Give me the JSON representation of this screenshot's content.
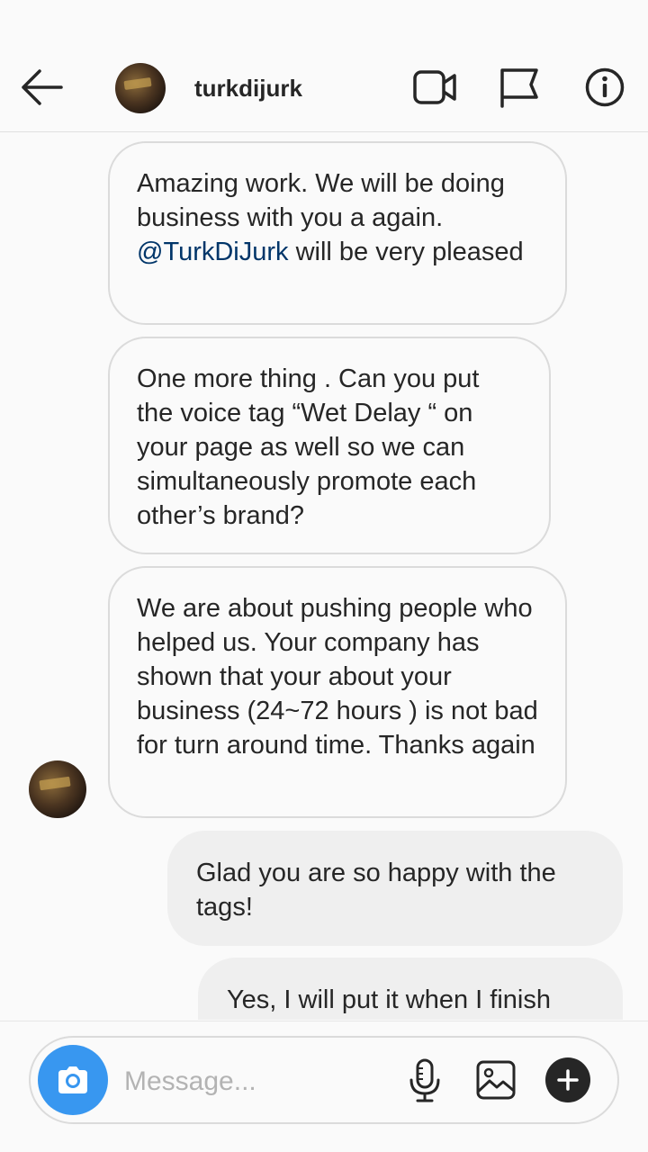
{
  "header": {
    "username": "turkdijurk"
  },
  "messages": [
    {
      "direction": "incoming",
      "parts": [
        "Amazing work. We will be doing business with you a again. ",
        "@TurkDiJurk",
        " will be very pleased"
      ]
    },
    {
      "direction": "incoming",
      "text": "One more thing . Can you put the voice tag “Wet Delay “ on your page as well so we can simultaneously promote each other’s brand?"
    },
    {
      "direction": "incoming",
      "text": "We are about pushing people who helped us. Your company has shown that your about your business (24~72 hours ) is not bad for turn around time. Thanks again"
    },
    {
      "direction": "outgoing",
      "text": "Glad you are so happy with the tags!"
    },
    {
      "direction": "outgoing",
      "text": "Yes, I will put it when I finish"
    }
  ],
  "composer": {
    "placeholder": "Message..."
  },
  "colors": {
    "accent": "#3897f0",
    "mention": "#003569",
    "outgoing_bubble": "#efefef",
    "incoming_border": "#dbdbdb"
  },
  "icons": [
    "back-arrow-icon",
    "video-call-icon",
    "flag-icon",
    "info-icon",
    "camera-icon",
    "microphone-icon",
    "gallery-icon",
    "plus-icon"
  ]
}
